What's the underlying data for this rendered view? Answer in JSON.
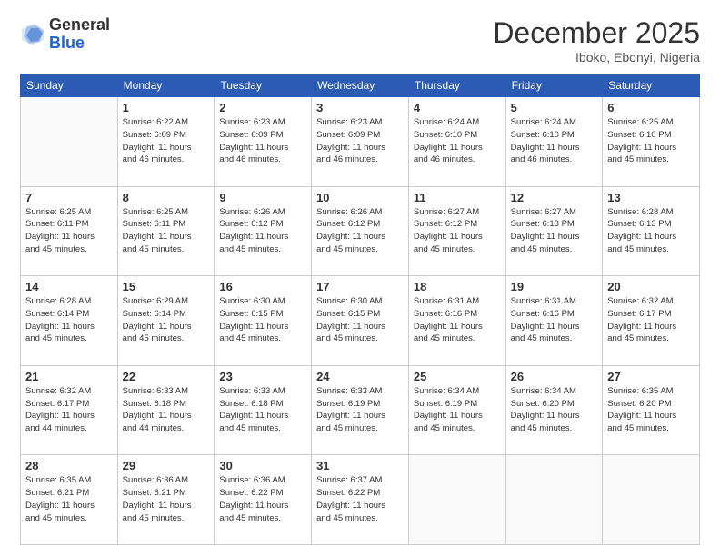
{
  "logo": {
    "general": "General",
    "blue": "Blue"
  },
  "header": {
    "month": "December 2025",
    "location": "Iboko, Ebonyi, Nigeria"
  },
  "days_of_week": [
    "Sunday",
    "Monday",
    "Tuesday",
    "Wednesday",
    "Thursday",
    "Friday",
    "Saturday"
  ],
  "weeks": [
    [
      {
        "day": "",
        "info": ""
      },
      {
        "day": "1",
        "info": "Sunrise: 6:22 AM\nSunset: 6:09 PM\nDaylight: 11 hours\nand 46 minutes."
      },
      {
        "day": "2",
        "info": "Sunrise: 6:23 AM\nSunset: 6:09 PM\nDaylight: 11 hours\nand 46 minutes."
      },
      {
        "day": "3",
        "info": "Sunrise: 6:23 AM\nSunset: 6:09 PM\nDaylight: 11 hours\nand 46 minutes."
      },
      {
        "day": "4",
        "info": "Sunrise: 6:24 AM\nSunset: 6:10 PM\nDaylight: 11 hours\nand 46 minutes."
      },
      {
        "day": "5",
        "info": "Sunrise: 6:24 AM\nSunset: 6:10 PM\nDaylight: 11 hours\nand 46 minutes."
      },
      {
        "day": "6",
        "info": "Sunrise: 6:25 AM\nSunset: 6:10 PM\nDaylight: 11 hours\nand 45 minutes."
      }
    ],
    [
      {
        "day": "7",
        "info": "Sunrise: 6:25 AM\nSunset: 6:11 PM\nDaylight: 11 hours\nand 45 minutes."
      },
      {
        "day": "8",
        "info": "Sunrise: 6:25 AM\nSunset: 6:11 PM\nDaylight: 11 hours\nand 45 minutes."
      },
      {
        "day": "9",
        "info": "Sunrise: 6:26 AM\nSunset: 6:12 PM\nDaylight: 11 hours\nand 45 minutes."
      },
      {
        "day": "10",
        "info": "Sunrise: 6:26 AM\nSunset: 6:12 PM\nDaylight: 11 hours\nand 45 minutes."
      },
      {
        "day": "11",
        "info": "Sunrise: 6:27 AM\nSunset: 6:12 PM\nDaylight: 11 hours\nand 45 minutes."
      },
      {
        "day": "12",
        "info": "Sunrise: 6:27 AM\nSunset: 6:13 PM\nDaylight: 11 hours\nand 45 minutes."
      },
      {
        "day": "13",
        "info": "Sunrise: 6:28 AM\nSunset: 6:13 PM\nDaylight: 11 hours\nand 45 minutes."
      }
    ],
    [
      {
        "day": "14",
        "info": "Sunrise: 6:28 AM\nSunset: 6:14 PM\nDaylight: 11 hours\nand 45 minutes."
      },
      {
        "day": "15",
        "info": "Sunrise: 6:29 AM\nSunset: 6:14 PM\nDaylight: 11 hours\nand 45 minutes."
      },
      {
        "day": "16",
        "info": "Sunrise: 6:30 AM\nSunset: 6:15 PM\nDaylight: 11 hours\nand 45 minutes."
      },
      {
        "day": "17",
        "info": "Sunrise: 6:30 AM\nSunset: 6:15 PM\nDaylight: 11 hours\nand 45 minutes."
      },
      {
        "day": "18",
        "info": "Sunrise: 6:31 AM\nSunset: 6:16 PM\nDaylight: 11 hours\nand 45 minutes."
      },
      {
        "day": "19",
        "info": "Sunrise: 6:31 AM\nSunset: 6:16 PM\nDaylight: 11 hours\nand 45 minutes."
      },
      {
        "day": "20",
        "info": "Sunrise: 6:32 AM\nSunset: 6:17 PM\nDaylight: 11 hours\nand 45 minutes."
      }
    ],
    [
      {
        "day": "21",
        "info": "Sunrise: 6:32 AM\nSunset: 6:17 PM\nDaylight: 11 hours\nand 44 minutes."
      },
      {
        "day": "22",
        "info": "Sunrise: 6:33 AM\nSunset: 6:18 PM\nDaylight: 11 hours\nand 44 minutes."
      },
      {
        "day": "23",
        "info": "Sunrise: 6:33 AM\nSunset: 6:18 PM\nDaylight: 11 hours\nand 45 minutes."
      },
      {
        "day": "24",
        "info": "Sunrise: 6:33 AM\nSunset: 6:19 PM\nDaylight: 11 hours\nand 45 minutes."
      },
      {
        "day": "25",
        "info": "Sunrise: 6:34 AM\nSunset: 6:19 PM\nDaylight: 11 hours\nand 45 minutes."
      },
      {
        "day": "26",
        "info": "Sunrise: 6:34 AM\nSunset: 6:20 PM\nDaylight: 11 hours\nand 45 minutes."
      },
      {
        "day": "27",
        "info": "Sunrise: 6:35 AM\nSunset: 6:20 PM\nDaylight: 11 hours\nand 45 minutes."
      }
    ],
    [
      {
        "day": "28",
        "info": "Sunrise: 6:35 AM\nSunset: 6:21 PM\nDaylight: 11 hours\nand 45 minutes."
      },
      {
        "day": "29",
        "info": "Sunrise: 6:36 AM\nSunset: 6:21 PM\nDaylight: 11 hours\nand 45 minutes."
      },
      {
        "day": "30",
        "info": "Sunrise: 6:36 AM\nSunset: 6:22 PM\nDaylight: 11 hours\nand 45 minutes."
      },
      {
        "day": "31",
        "info": "Sunrise: 6:37 AM\nSunset: 6:22 PM\nDaylight: 11 hours\nand 45 minutes."
      },
      {
        "day": "",
        "info": ""
      },
      {
        "day": "",
        "info": ""
      },
      {
        "day": "",
        "info": ""
      }
    ]
  ]
}
